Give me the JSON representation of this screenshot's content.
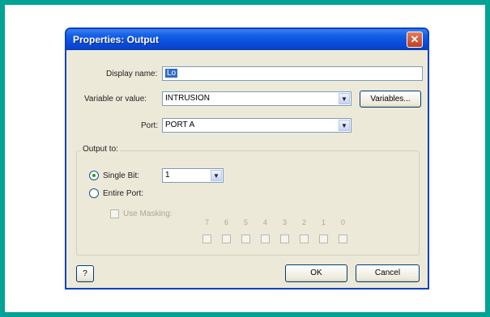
{
  "dialog": {
    "title": "Properties: Output",
    "close_glyph": "✕",
    "display_name": {
      "label": "Display name:",
      "value": "Lo"
    },
    "variable": {
      "label": "Variable or value:",
      "value": "INTRUSION",
      "button": "Variables..."
    },
    "port": {
      "label": "Port:",
      "value": "PORT A"
    },
    "output_to": {
      "label": "Output to:",
      "single_bit": {
        "label": "Single Bit:",
        "selected": true,
        "value": "1"
      },
      "entire_port": {
        "label": "Entire Port:",
        "selected": false
      },
      "use_masking": {
        "label": "Use Masking:",
        "checked": false,
        "enabled": false
      },
      "bits": [
        "7",
        "6",
        "5",
        "4",
        "3",
        "2",
        "1",
        "0"
      ]
    },
    "help_label": "?",
    "ok_label": "OK",
    "cancel_label": "Cancel"
  },
  "colors": {
    "frame": "#00a396",
    "titlebar": "#0a4bd9",
    "dialog_bg": "#ece9d8"
  }
}
